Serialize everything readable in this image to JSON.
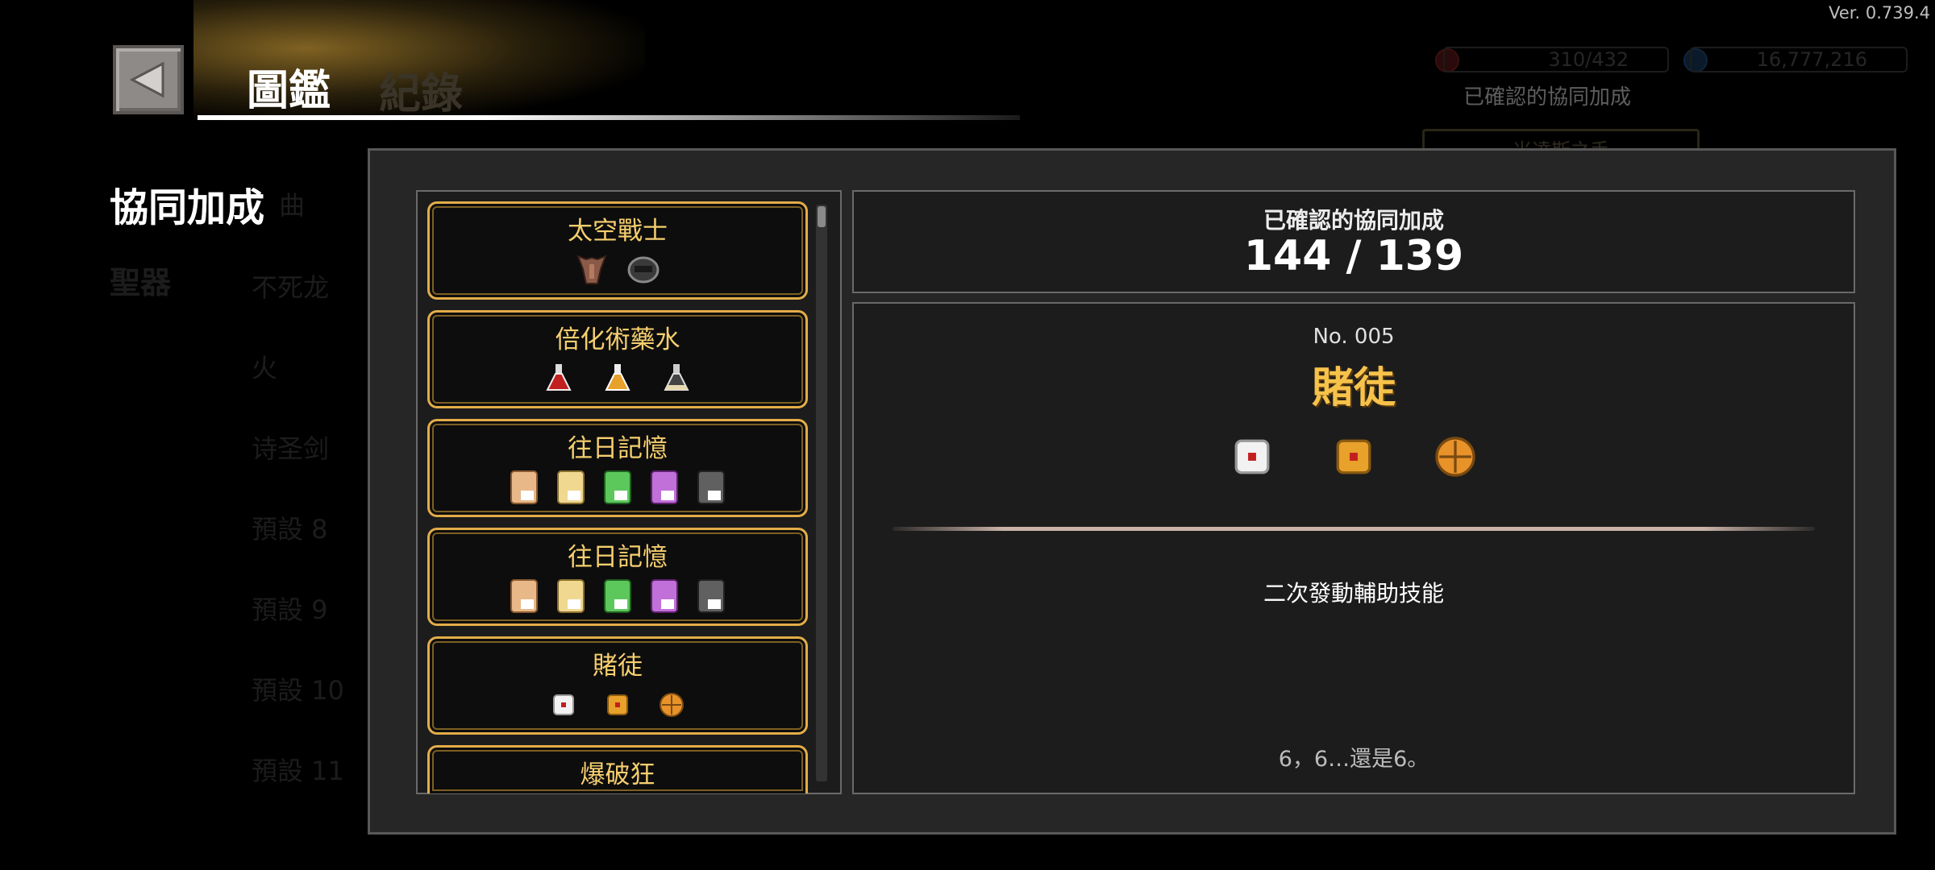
{
  "version": "Ver. 0.739.4",
  "header": {
    "title": "圖鑑",
    "title_ghost": "紀錄"
  },
  "background": {
    "resource_1": "310/432",
    "resource_2": "16,777,216",
    "confirmed_label": "已確認的協同加成",
    "banner": "米達斯之手",
    "side_title": "協同加成",
    "side_sub": "聖器",
    "list": [
      "曲",
      "不死龙",
      "火",
      "诗圣剑",
      "預設 8",
      "預設 9",
      "預設 10",
      "預設 11"
    ]
  },
  "synergy_list": [
    {
      "label": "太空戰士",
      "items": [
        "armor-icon",
        "helmet-icon"
      ]
    },
    {
      "label": "倍化術藥水",
      "items": [
        "red-potion-icon",
        "gold-potion-icon",
        "white-potion-icon"
      ]
    },
    {
      "label": "往日記憶",
      "items": [
        "memory-i-icon",
        "memory-ii-icon",
        "memory-iii-icon",
        "memory-iv-icon",
        "memory-v-icon"
      ]
    },
    {
      "label": "往日記憶",
      "items": [
        "memory-i-icon",
        "memory-ii-icon",
        "memory-iii-icon",
        "memory-iv-icon",
        "memory-v-icon"
      ]
    },
    {
      "label": "賭徒",
      "items": [
        "white-dice-icon",
        "gold-dice-icon",
        "roulette-icon"
      ]
    },
    {
      "label": "爆破狂",
      "items": []
    }
  ],
  "confirmed": {
    "label": "已確認的協同加成",
    "value": "144 / 139"
  },
  "detail": {
    "number": "No. 005",
    "name": "賭徒",
    "icons": [
      "white-dice-icon",
      "gold-dice-icon",
      "roulette-icon"
    ],
    "effect": "二次發動輔助技能",
    "flavor": "6，6…還是6。"
  },
  "colors": {
    "accent_gold": "#f6cf6e",
    "card_border": "#e3ad48",
    "panel": "#1c1c1c",
    "modal": "#262626"
  }
}
